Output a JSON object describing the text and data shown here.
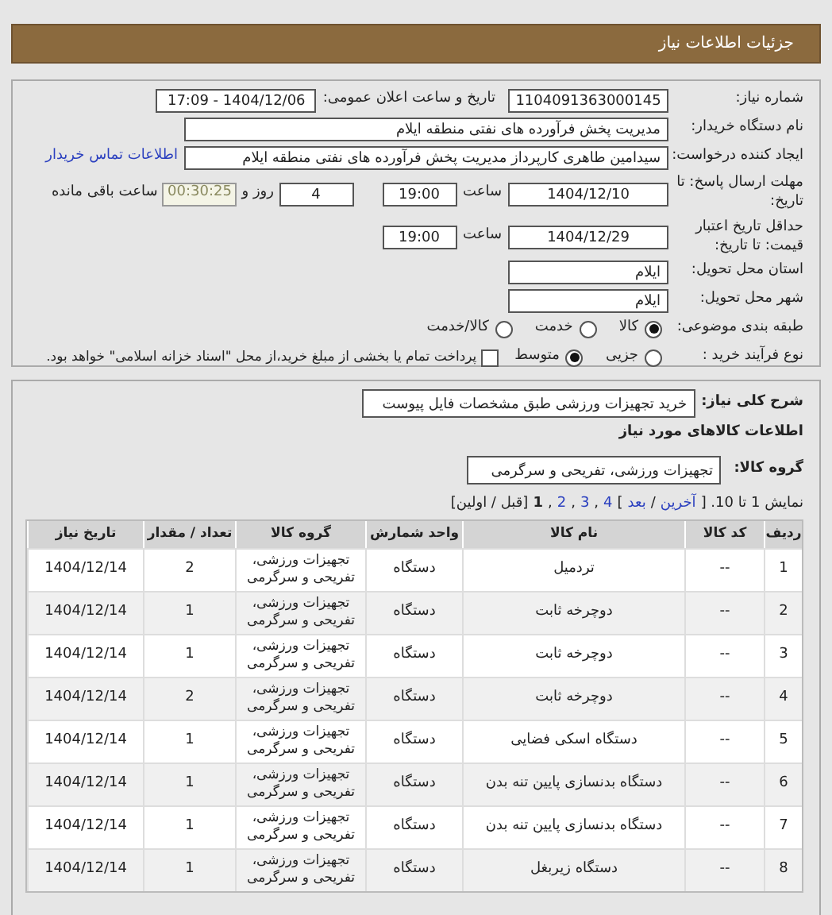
{
  "header": {
    "title": "جزئیات اطلاعات نیاز"
  },
  "need_number": {
    "label": "شماره نیاز:",
    "value": "1104091363000145"
  },
  "announce": {
    "label": "تاریخ و ساعت اعلان عمومی:",
    "value": "1404/12/06 - 17:09"
  },
  "buyer": {
    "label": "نام دستگاه خریدار:",
    "value": "مدیریت پخش فرآورده های نفتی منطقه ایلام"
  },
  "creator": {
    "label": "ایجاد کننده درخواست:",
    "value": "سیدامین طاهری کارپرداز مدیریت پخش فرآورده های نفتی منطقه ایلام",
    "link": "اطلاعات تماس خریدار"
  },
  "deadline": {
    "label": "مهلت ارسال پاسخ: تا تاریخ:",
    "date": "1404/12/10",
    "time_label": "ساعت",
    "time": "19:00",
    "days": "4",
    "days_label": "روز و",
    "remaining": "00:30:25",
    "remaining_label": "ساعت باقی مانده"
  },
  "validity": {
    "label": "حداقل تاریخ اعتبار قیمت: تا تاریخ:",
    "date": "1404/12/29",
    "time_label": "ساعت",
    "time": "19:00"
  },
  "province": {
    "label": "استان محل تحویل:",
    "value": "ایلام"
  },
  "city": {
    "label": "شهر محل تحویل:",
    "value": "ایلام"
  },
  "category": {
    "label": "طبقه بندی موضوعی:",
    "options": [
      {
        "label": "کالا",
        "selected": true
      },
      {
        "label": "خدمت",
        "selected": false
      },
      {
        "label": "کالا/خدمت",
        "selected": false
      }
    ]
  },
  "process": {
    "label": "نوع فرآیند خرید :",
    "options": [
      {
        "label": "جزیی",
        "selected": false
      },
      {
        "label": "متوسط",
        "selected": true
      }
    ],
    "payment": {
      "checked": false,
      "text": "پرداخت تمام یا بخشی از مبلغ خرید،از محل \"اسناد خزانه اسلامی\" خواهد بود."
    }
  },
  "description": {
    "label": "شرح کلی نیاز:",
    "value": "خرید تجهیزات ورزشی طبق مشخصات فایل پیوست"
  },
  "goods_title": "اطلاعات کالاهای مورد نیاز",
  "goods_group": {
    "label": "گروه کالا:",
    "value": "تجهیزات ورزشی، تفریحی و سرگرمی"
  },
  "pagination": [
    {
      "kind": "text",
      "text": "نمایش 1 تا 10. ["
    },
    {
      "kind": "link",
      "text": "آخرین"
    },
    {
      "kind": "text",
      "text": "/"
    },
    {
      "kind": "link",
      "text": "بعد"
    },
    {
      "kind": "text",
      "text": "]"
    },
    {
      "kind": "link",
      "text": "4"
    },
    {
      "kind": "text",
      "text": ","
    },
    {
      "kind": "link",
      "text": "3"
    },
    {
      "kind": "text",
      "text": ","
    },
    {
      "kind": "link",
      "text": "2"
    },
    {
      "kind": "text",
      "text": ","
    },
    {
      "kind": "current",
      "text": "1"
    },
    {
      "kind": "text",
      "text": "[قبل / اولین]"
    }
  ],
  "table": {
    "columns": [
      "ردیف",
      "کد کالا",
      "نام کالا",
      "واحد شمارش",
      "گروه کالا",
      "تعداد / مقدار",
      "تاریخ نیاز"
    ],
    "rows": [
      [
        "1",
        "--",
        "تردمیل",
        "دستگاه",
        "تجهیزات ورزشی، تفریحی و سرگرمی",
        "2",
        "1404/12/14"
      ],
      [
        "2",
        "--",
        "دوچرخه ثابت",
        "دستگاه",
        "تجهیزات ورزشی، تفریحی و سرگرمی",
        "1",
        "1404/12/14"
      ],
      [
        "3",
        "--",
        "دوچرخه ثابت",
        "دستگاه",
        "تجهیزات ورزشی، تفریحی و سرگرمی",
        "1",
        "1404/12/14"
      ],
      [
        "4",
        "--",
        "دوچرخه ثابت",
        "دستگاه",
        "تجهیزات ورزشی، تفریحی و سرگرمی",
        "2",
        "1404/12/14"
      ],
      [
        "5",
        "--",
        "دستگاه اسکی فضایی",
        "دستگاه",
        "تجهیزات ورزشی، تفریحی و سرگرمی",
        "1",
        "1404/12/14"
      ],
      [
        "6",
        "--",
        "دستگاه بدنسازی پایین تنه بدن",
        "دستگاه",
        "تجهیزات ورزشی، تفریحی و سرگرمی",
        "1",
        "1404/12/14"
      ],
      [
        "7",
        "--",
        "دستگاه بدنسازی پایین تنه بدن",
        "دستگاه",
        "تجهیزات ورزشی، تفریحی و سرگرمی",
        "1",
        "1404/12/14"
      ],
      [
        "8",
        "--",
        "دستگاه زیربغل",
        "دستگاه",
        "تجهیزات ورزشی، تفریحی و سرگرمی",
        "1",
        "1404/12/14"
      ]
    ]
  }
}
